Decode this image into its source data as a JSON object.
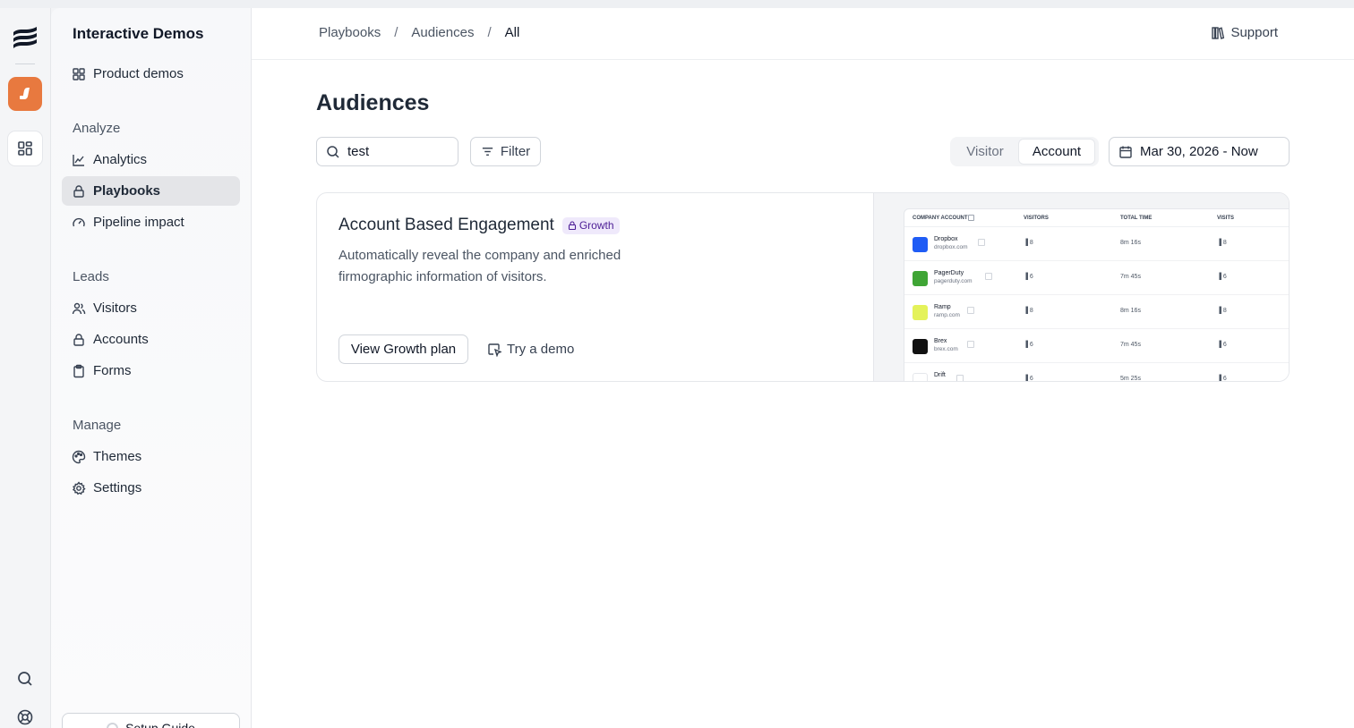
{
  "sidebar": {
    "title": "Interactive Demos",
    "product_demos": "Product demos",
    "sections": {
      "analyze": "Analyze",
      "leads": "Leads",
      "manage": "Manage"
    },
    "items": {
      "analytics": "Analytics",
      "playbooks": "Playbooks",
      "pipeline_impact": "Pipeline impact",
      "visitors": "Visitors",
      "accounts": "Accounts",
      "forms": "Forms",
      "themes": "Themes",
      "settings": "Settings"
    },
    "setup_guide": "Setup Guide",
    "active_item": "playbooks"
  },
  "breadcrumb": [
    "Playbooks",
    "Audiences",
    "All"
  ],
  "breadcrumb_sep": "/",
  "support_label": "Support",
  "page_title": "Audiences",
  "search": {
    "value": "test"
  },
  "filter_label": "Filter",
  "toggle": {
    "visitor": "Visitor",
    "account": "Account",
    "selected": "Account"
  },
  "date_range": "Mar 30, 2026 - Now",
  "card": {
    "title": "Account Based Engagement",
    "badge": "Growth",
    "description": "Automatically reveal the company and enriched firmographic information of visitors.",
    "primary_button": "View Growth plan",
    "secondary_button": "Try a demo",
    "preview": {
      "columns": [
        "COMPANY ACCOUNT",
        "VISITORS",
        "TOTAL TIME",
        "VISITS"
      ],
      "rows": [
        {
          "name": "Dropbox",
          "domain": "dropbox.com",
          "visitors": "8",
          "time": "8m 16s",
          "visits": "8",
          "color": "#1f5cf5"
        },
        {
          "name": "PagerDuty",
          "domain": "pagerduty.com",
          "visitors": "6",
          "time": "7m 45s",
          "visits": "6",
          "color": "#3fa535"
        },
        {
          "name": "Ramp",
          "domain": "ramp.com",
          "visitors": "8",
          "time": "8m 16s",
          "visits": "8",
          "color": "#e4f25a"
        },
        {
          "name": "Brex",
          "domain": "brex.com",
          "visitors": "6",
          "time": "7m 45s",
          "visits": "6",
          "color": "#111111"
        },
        {
          "name": "Drift",
          "domain": "",
          "visitors": "6",
          "time": "5m 25s",
          "visits": "6",
          "color": "#ffffff"
        }
      ]
    }
  },
  "colors": {
    "accent_app": "#e8793f",
    "badge_bg": "#efe9fb",
    "badge_text": "#4c1d95"
  },
  "icons": [
    "brand-logo-icon",
    "app-icon",
    "grid-icon",
    "search-icon",
    "help-icon",
    "book-icon",
    "calendar-icon",
    "filter-icon",
    "lock-icon",
    "cursor-icon"
  ]
}
